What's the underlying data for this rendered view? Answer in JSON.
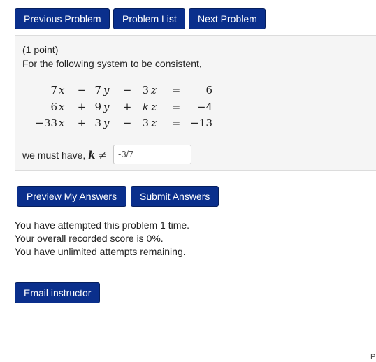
{
  "nav": {
    "prev_label": "Previous Problem",
    "list_label": "Problem List",
    "next_label": "Next Problem"
  },
  "problem": {
    "points": "(1 point)",
    "prompt": "For the following system to be consistent,",
    "equations": [
      {
        "a": "7",
        "x": "x",
        "op1": "−",
        "b": "7",
        "y": "y",
        "op2": "−",
        "c": "3",
        "z": "z",
        "eq": "=",
        "rhs": "6"
      },
      {
        "a": "6",
        "x": "x",
        "op1": "+",
        "b": "9",
        "y": "y",
        "op2": "+",
        "c": "k",
        "z": "z",
        "eq": "=",
        "rhs": "−4"
      },
      {
        "a": "−33",
        "x": "x",
        "op1": "+",
        "b": "3",
        "y": "y",
        "op2": "−",
        "c": "3",
        "z": "z",
        "eq": "=",
        "rhs": "−13"
      }
    ],
    "must_have_text": "we must have,",
    "k_symbol": "k",
    "neq_symbol": "≠",
    "answer_value": "-3/7"
  },
  "actions": {
    "preview_label": "Preview My Answers",
    "submit_label": "Submit Answers"
  },
  "status": {
    "attempts": "You have attempted this problem 1 time.",
    "score": "Your overall recorded score is 0%.",
    "remaining": "You have unlimited attempts remaining."
  },
  "email_label": "Email instructor",
  "corner_text": "P",
  "colors": {
    "button_bg": "#0a2f8c",
    "button_text": "#ffffff",
    "panel_bg": "#f5f5f5"
  }
}
